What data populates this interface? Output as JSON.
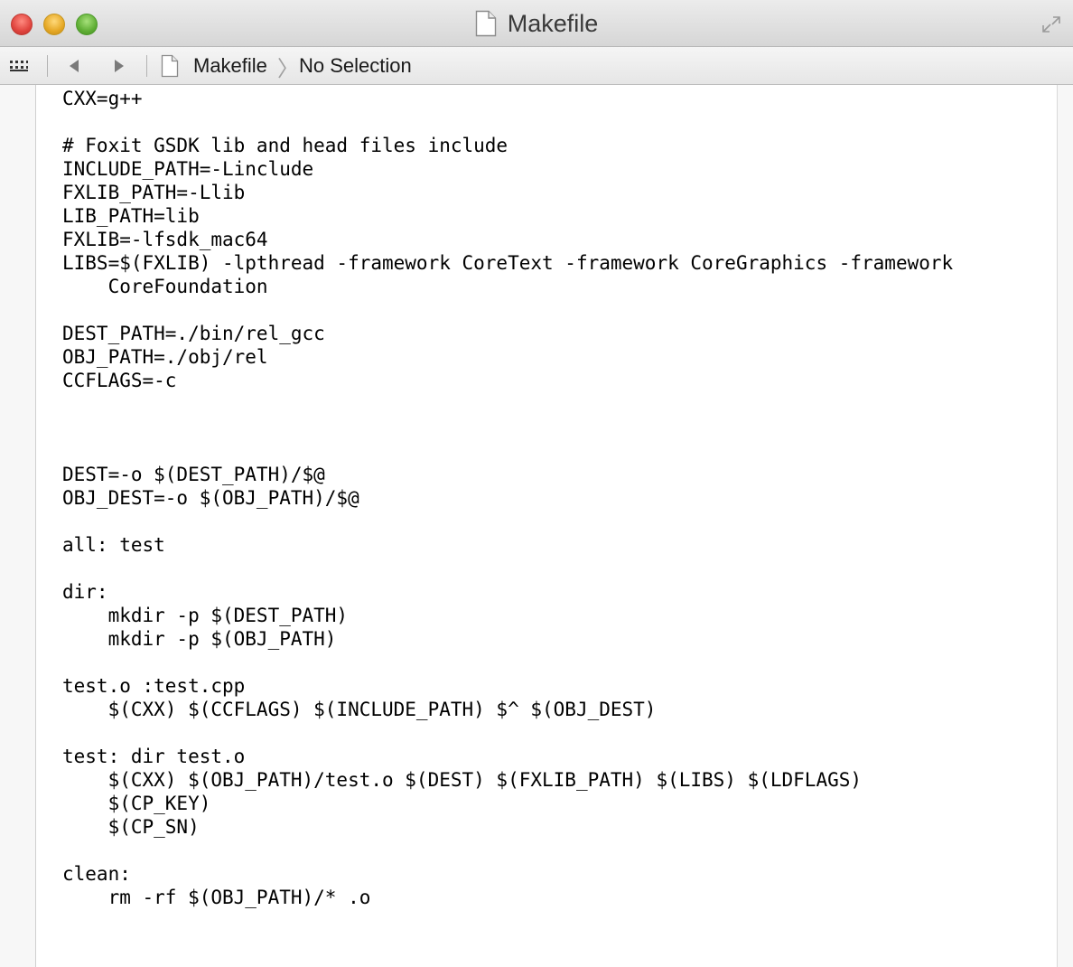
{
  "window": {
    "title": "Makefile"
  },
  "jumpbar": {
    "filename": "Makefile",
    "separator": "〉",
    "selection": "No Selection"
  },
  "editor": {
    "lines": [
      "CXX=g++",
      "",
      "# Foxit GSDK lib and head files include",
      "INCLUDE_PATH=-Linclude",
      "FXLIB_PATH=-Llib",
      "LIB_PATH=lib",
      "FXLIB=-lfsdk_mac64",
      "LIBS=$(FXLIB) -lpthread -framework CoreText -framework CoreGraphics -framework",
      "    CoreFoundation",
      "",
      "DEST_PATH=./bin/rel_gcc",
      "OBJ_PATH=./obj/rel",
      "CCFLAGS=-c",
      "",
      "",
      "",
      "DEST=-o $(DEST_PATH)/$@",
      "OBJ_DEST=-o $(OBJ_PATH)/$@",
      "",
      "all: test",
      "",
      "dir:",
      "    mkdir -p $(DEST_PATH)",
      "    mkdir -p $(OBJ_PATH)",
      "",
      "test.o :test.cpp",
      "    $(CXX) $(CCFLAGS) $(INCLUDE_PATH) $^ $(OBJ_DEST)",
      "",
      "test: dir test.o",
      "    $(CXX) $(OBJ_PATH)/test.o $(DEST) $(FXLIB_PATH) $(LIBS) $(LDFLAGS)",
      "    $(CP_KEY)",
      "    $(CP_SN)",
      "",
      "clean:",
      "    rm -rf $(OBJ_PATH)/* .o"
    ]
  }
}
